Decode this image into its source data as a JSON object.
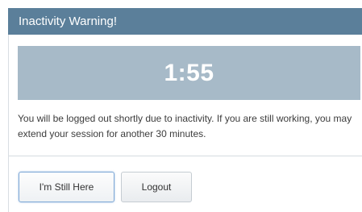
{
  "dialog": {
    "title": "Inactivity Warning!",
    "countdown": "1:55",
    "message": "You will be logged out shortly due to inactivity. If you are still working, you may extend your session for another 30 minutes.",
    "buttons": {
      "stay_label": "I'm Still Here",
      "logout_label": "Logout"
    }
  },
  "colors": {
    "header_bg": "#5b7f9a",
    "countdown_bg": "#a7bac8",
    "primary_button_border": "#7ea8d6"
  }
}
